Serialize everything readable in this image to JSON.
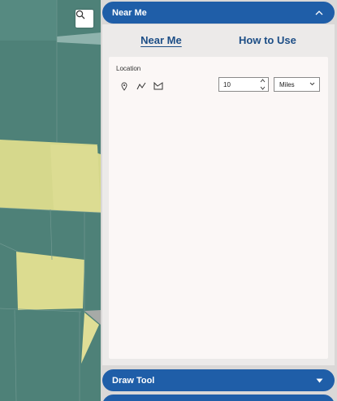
{
  "panel": {
    "near_me_header": "Near Me",
    "draw_tool_header": "Draw Tool",
    "tabs": [
      {
        "label": "Near Me",
        "active": true
      },
      {
        "label": "How to Use",
        "active": false
      }
    ],
    "location_label": "Location",
    "distance_value": "10",
    "unit_selected": "Miles"
  },
  "colors": {
    "header_blue": "#1f5ea8",
    "tab_text": "#1d4e86",
    "map_teal": "#4e8178",
    "map_yellow": "#d9da8e"
  },
  "icons": [
    "search-icon",
    "chevron-up-icon",
    "point-tool-icon",
    "line-tool-icon",
    "polygon-tool-icon",
    "chevron-down-icon",
    "caret-down-icon"
  ]
}
